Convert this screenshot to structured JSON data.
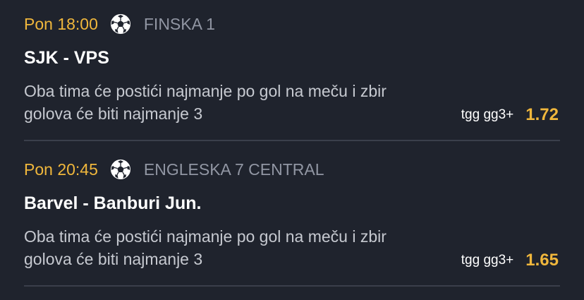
{
  "bets": [
    {
      "time": "Pon 18:00",
      "sport_icon": "soccer-ball-icon",
      "league": "FINSKA 1",
      "match": "SJK - VPS",
      "description_line1": "Oba tima će postići najmanje po gol na meču i zbir",
      "description_line2": "golova će biti najmanje 3",
      "tip_code": "tgg gg3+",
      "odd": "1.72"
    },
    {
      "time": "Pon 20:45",
      "sport_icon": "soccer-ball-icon",
      "league": "ENGLESKA 7 CENTRAL",
      "match": "Barvel - Banburi Jun.",
      "description_line1": "Oba tima će postići najmanje po gol na meču i zbir",
      "description_line2": "golova će biti najmanje 3",
      "tip_code": "tgg gg3+",
      "odd": "1.65"
    }
  ],
  "colors": {
    "background": "#1f232d",
    "accent": "#f0b73c",
    "muted": "#9196a3",
    "divider": "#3a3f4b"
  }
}
